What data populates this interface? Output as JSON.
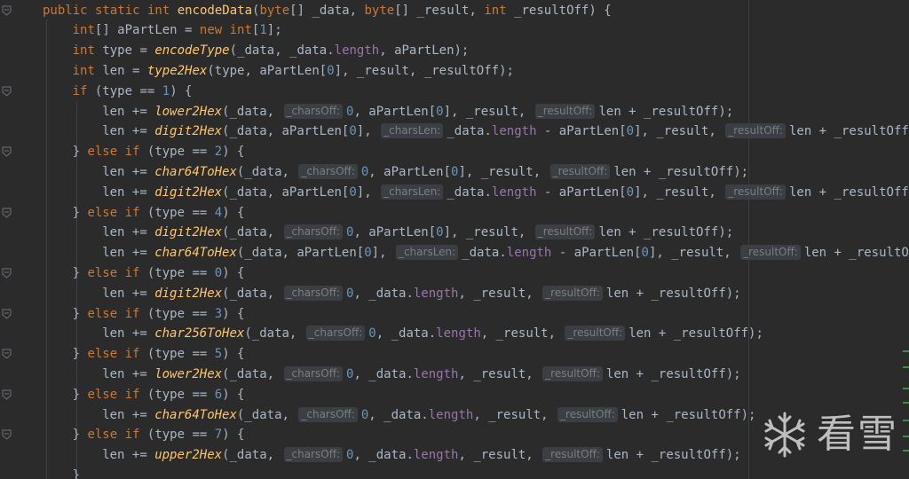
{
  "editor": {
    "lines": [
      [
        [
          "kw",
          "public static int "
        ],
        [
          "fn",
          "encodeData"
        ],
        [
          "p",
          "("
        ],
        [
          "kw",
          "byte"
        ],
        [
          "p",
          "[] _data, "
        ],
        [
          "kw",
          "byte"
        ],
        [
          "p",
          "[] _result, "
        ],
        [
          "kw",
          "int"
        ],
        [
          "p",
          " _resultOff) {"
        ]
      ],
      [
        [
          "kw",
          "int"
        ],
        [
          "p",
          "[] aPartLen = "
        ],
        [
          "kw",
          "new int"
        ],
        [
          "p",
          "["
        ],
        [
          "num",
          "1"
        ],
        [
          "p",
          "];"
        ]
      ],
      [
        [
          "kw",
          "int"
        ],
        [
          "p",
          " type = "
        ],
        [
          "it",
          "encodeType"
        ],
        [
          "p",
          "(_data, _data."
        ],
        [
          "fld",
          "length"
        ],
        [
          "p",
          ", aPartLen);"
        ]
      ],
      [
        [
          "kw",
          "int"
        ],
        [
          "p",
          " len = "
        ],
        [
          "it",
          "type2Hex"
        ],
        [
          "p",
          "(type, aPartLen["
        ],
        [
          "num",
          "0"
        ],
        [
          "p",
          "], _result, _resultOff);"
        ]
      ],
      [
        [
          "kw",
          "if"
        ],
        [
          "p",
          " (type == "
        ],
        [
          "num",
          "1"
        ],
        [
          "p",
          ") {"
        ]
      ],
      [
        [
          "p",
          "len += "
        ],
        [
          "it",
          "lower2Hex"
        ],
        [
          "p",
          "(_data, "
        ],
        [
          "hint",
          "_charsOff:"
        ],
        [
          "num",
          "0"
        ],
        [
          "p",
          ", aPartLen["
        ],
        [
          "num",
          "0"
        ],
        [
          "p",
          "], _result, "
        ],
        [
          "hint",
          "_resultOff:"
        ],
        [
          "p",
          "len + _resultOff);"
        ]
      ],
      [
        [
          "p",
          "len += "
        ],
        [
          "it",
          "digit2Hex"
        ],
        [
          "p",
          "(_data, aPartLen["
        ],
        [
          "num",
          "0"
        ],
        [
          "p",
          "], "
        ],
        [
          "hint",
          "_charsLen:"
        ],
        [
          "p",
          "_data."
        ],
        [
          "fld",
          "length"
        ],
        [
          "p",
          " - aPartLen["
        ],
        [
          "num",
          "0"
        ],
        [
          "p",
          "], _result, "
        ],
        [
          "hint",
          "_resultOff:"
        ],
        [
          "p",
          "len + _resultOff);"
        ]
      ],
      [
        [
          "p",
          "} "
        ],
        [
          "kw",
          "else if"
        ],
        [
          "p",
          " (type == "
        ],
        [
          "num",
          "2"
        ],
        [
          "p",
          ") {"
        ]
      ],
      [
        [
          "p",
          "len += "
        ],
        [
          "it",
          "char64ToHex"
        ],
        [
          "p",
          "(_data, "
        ],
        [
          "hint",
          "_charsOff:"
        ],
        [
          "num",
          "0"
        ],
        [
          "p",
          ", aPartLen["
        ],
        [
          "num",
          "0"
        ],
        [
          "p",
          "], _result, "
        ],
        [
          "hint",
          "_resultOff:"
        ],
        [
          "p",
          "len + _resultOff);"
        ]
      ],
      [
        [
          "p",
          "len += "
        ],
        [
          "it",
          "digit2Hex"
        ],
        [
          "p",
          "(_data, aPartLen["
        ],
        [
          "num",
          "0"
        ],
        [
          "p",
          "], "
        ],
        [
          "hint",
          "_charsLen:"
        ],
        [
          "p",
          "_data."
        ],
        [
          "fld",
          "length"
        ],
        [
          "p",
          " - aPartLen["
        ],
        [
          "num",
          "0"
        ],
        [
          "p",
          "], _result, "
        ],
        [
          "hint",
          "_resultOff:"
        ],
        [
          "p",
          "len + _resultOff);"
        ]
      ],
      [
        [
          "p",
          "} "
        ],
        [
          "kw",
          "else if"
        ],
        [
          "p",
          " (type == "
        ],
        [
          "num",
          "4"
        ],
        [
          "p",
          ") {"
        ]
      ],
      [
        [
          "p",
          "len += "
        ],
        [
          "it",
          "digit2Hex"
        ],
        [
          "p",
          "(_data, "
        ],
        [
          "hint",
          "_charsOff:"
        ],
        [
          "num",
          "0"
        ],
        [
          "p",
          ", aPartLen["
        ],
        [
          "num",
          "0"
        ],
        [
          "p",
          "], _result, "
        ],
        [
          "hint",
          "_resultOff:"
        ],
        [
          "p",
          "len + _resultOff);"
        ]
      ],
      [
        [
          "p",
          "len += "
        ],
        [
          "it",
          "char64ToHex"
        ],
        [
          "p",
          "(_data, aPartLen["
        ],
        [
          "num",
          "0"
        ],
        [
          "p",
          "], "
        ],
        [
          "hint",
          "_charsLen:"
        ],
        [
          "p",
          "_data."
        ],
        [
          "fld",
          "length"
        ],
        [
          "p",
          " - aPartLen["
        ],
        [
          "num",
          "0"
        ],
        [
          "p",
          "], _result, "
        ],
        [
          "hint",
          "_resultOff:"
        ],
        [
          "p",
          "len + _resultOff);"
        ]
      ],
      [
        [
          "p",
          "} "
        ],
        [
          "kw",
          "else if"
        ],
        [
          "p",
          " (type == "
        ],
        [
          "num",
          "0"
        ],
        [
          "p",
          ") {"
        ]
      ],
      [
        [
          "p",
          "len += "
        ],
        [
          "it",
          "digit2Hex"
        ],
        [
          "p",
          "(_data, "
        ],
        [
          "hint",
          "_charsOff:"
        ],
        [
          "num",
          "0"
        ],
        [
          "p",
          ", _data."
        ],
        [
          "fld",
          "length"
        ],
        [
          "p",
          ", _result, "
        ],
        [
          "hint",
          "_resultOff:"
        ],
        [
          "p",
          "len + _resultOff);"
        ]
      ],
      [
        [
          "p",
          "} "
        ],
        [
          "kw",
          "else if"
        ],
        [
          "p",
          " (type == "
        ],
        [
          "num",
          "3"
        ],
        [
          "p",
          ") {"
        ]
      ],
      [
        [
          "p",
          "len += "
        ],
        [
          "it",
          "char256ToHex"
        ],
        [
          "p",
          "(_data, "
        ],
        [
          "hint",
          "_charsOff:"
        ],
        [
          "num",
          "0"
        ],
        [
          "p",
          ", _data."
        ],
        [
          "fld",
          "length"
        ],
        [
          "p",
          ", _result, "
        ],
        [
          "hint",
          "_resultOff:"
        ],
        [
          "p",
          "len + _resultOff);"
        ]
      ],
      [
        [
          "p",
          "} "
        ],
        [
          "kw",
          "else if"
        ],
        [
          "p",
          " (type == "
        ],
        [
          "num",
          "5"
        ],
        [
          "p",
          ") {"
        ]
      ],
      [
        [
          "p",
          "len += "
        ],
        [
          "it",
          "lower2Hex"
        ],
        [
          "p",
          "(_data, "
        ],
        [
          "hint",
          "_charsOff:"
        ],
        [
          "num",
          "0"
        ],
        [
          "p",
          ", _data."
        ],
        [
          "fld",
          "length"
        ],
        [
          "p",
          ", _result, "
        ],
        [
          "hint",
          "_resultOff:"
        ],
        [
          "p",
          "len + _resultOff);"
        ]
      ],
      [
        [
          "p",
          "} "
        ],
        [
          "kw",
          "else if"
        ],
        [
          "p",
          " (type == "
        ],
        [
          "num",
          "6"
        ],
        [
          "p",
          ") {"
        ]
      ],
      [
        [
          "p",
          "len += "
        ],
        [
          "it",
          "char64ToHex"
        ],
        [
          "p",
          "(_data, "
        ],
        [
          "hint",
          "_charsOff:"
        ],
        [
          "num",
          "0"
        ],
        [
          "p",
          ", _data."
        ],
        [
          "fld",
          "length"
        ],
        [
          "p",
          ", _result, "
        ],
        [
          "hint",
          "_resultOff:"
        ],
        [
          "p",
          "len + _resultOff);"
        ]
      ],
      [
        [
          "p",
          "} "
        ],
        [
          "kw",
          "else if"
        ],
        [
          "p",
          " (type == "
        ],
        [
          "num",
          "7"
        ],
        [
          "p",
          ") {"
        ]
      ],
      [
        [
          "p",
          "len += "
        ],
        [
          "it",
          "upper2Hex"
        ],
        [
          "p",
          "(_data, "
        ],
        [
          "hint",
          "_charsOff:"
        ],
        [
          "num",
          "0"
        ],
        [
          "p",
          ", _data."
        ],
        [
          "fld",
          "length"
        ],
        [
          "p",
          ", _result, "
        ],
        [
          "hint",
          "_resultOff:"
        ],
        [
          "p",
          "len + _resultOff);"
        ]
      ],
      [
        [
          "p",
          "}"
        ]
      ]
    ],
    "indent_levels": [
      0,
      1,
      1,
      1,
      1,
      2,
      2,
      1,
      2,
      2,
      1,
      2,
      2,
      1,
      2,
      1,
      2,
      1,
      2,
      1,
      2,
      1,
      2,
      1
    ],
    "fold_lines": [
      0,
      4,
      7,
      10,
      13,
      15,
      17,
      19,
      21
    ],
    "colors": {
      "background": "#2b2b2b",
      "keyword": "#cc7832",
      "method": "#ffc66d",
      "number": "#6897bb",
      "field": "#9876aa",
      "text": "#a9b7c6",
      "hint_bg": "#3b3e42",
      "hint_text": "#7a7e85"
    }
  },
  "watermark": {
    "icon": "snowflake-logo-icon",
    "text": "看雪"
  }
}
